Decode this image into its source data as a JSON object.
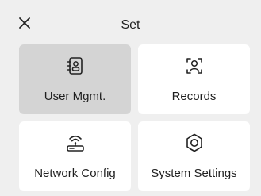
{
  "header": {
    "title": "Set",
    "close_icon": "close-icon"
  },
  "tiles": [
    {
      "label": "User Mgmt.",
      "icon": "user-book-icon",
      "selected": true
    },
    {
      "label": "Records",
      "icon": "face-scan-icon",
      "selected": false
    },
    {
      "label": "Network Config",
      "icon": "wifi-router-icon",
      "selected": false
    },
    {
      "label": "System Settings",
      "icon": "gear-icon",
      "selected": false
    }
  ],
  "colors": {
    "background": "#efefef",
    "tile": "#ffffff",
    "tile_selected": "#d4d4d4",
    "text": "#1f1f1f"
  }
}
